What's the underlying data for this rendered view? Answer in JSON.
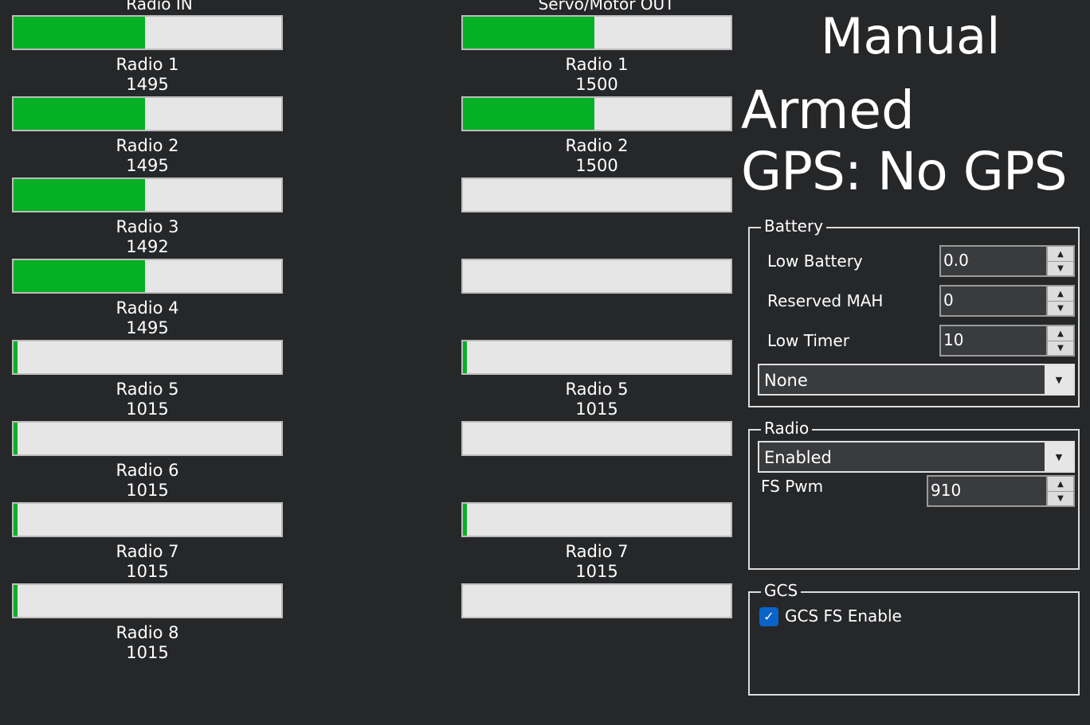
{
  "radio_in": {
    "title": "Radio IN",
    "channels": [
      {
        "label": "Radio 1",
        "value": "1495",
        "level": 0.49
      },
      {
        "label": "Radio 2",
        "value": "1495",
        "level": 0.49
      },
      {
        "label": "Radio 3",
        "value": "1492",
        "level": 0.49
      },
      {
        "label": "Radio 4",
        "value": "1495",
        "level": 0.49
      },
      {
        "label": "Radio 5",
        "value": "1015",
        "level": 0.015
      },
      {
        "label": "Radio 6",
        "value": "1015",
        "level": 0.015
      },
      {
        "label": "Radio 7",
        "value": "1015",
        "level": 0.015
      },
      {
        "label": "Radio 8",
        "value": "1015",
        "level": 0.015
      }
    ]
  },
  "servo_out": {
    "title": "Servo/Motor OUT",
    "channels": [
      {
        "label": "Radio 1",
        "value": "1500",
        "level": 0.49
      },
      {
        "label": "Radio 2",
        "value": "1500",
        "level": 0.49
      },
      {
        "label": "",
        "value": "",
        "level": 0
      },
      {
        "label": "",
        "value": "",
        "level": 0
      },
      {
        "label": "Radio 5",
        "value": "1015",
        "level": 0.015
      },
      {
        "label": "",
        "value": "",
        "level": 0
      },
      {
        "label": "Radio 7",
        "value": "1015",
        "level": 0.015
      },
      {
        "label": "",
        "value": "",
        "level": 0
      }
    ]
  },
  "status": {
    "mode": "Manual",
    "armed": "Armed",
    "gps": "GPS: No GPS"
  },
  "battery": {
    "title": "Battery",
    "low_battery_label": "Low Battery",
    "low_battery_value": "0.0",
    "reserved_mah_label": "Reserved MAH",
    "reserved_mah_value": "0",
    "low_timer_label": "Low Timer",
    "low_timer_value": "10",
    "action_selected": "None"
  },
  "radio": {
    "title": "Radio",
    "mode_selected": "Enabled",
    "fs_pwm_label": "FS Pwm",
    "fs_pwm_value": "910"
  },
  "gcs": {
    "title": "GCS",
    "fs_enable_label": "GCS FS Enable",
    "fs_enable_checked": true
  },
  "colors": {
    "background": "#262729",
    "bar_fill": "#06b025",
    "bar_track": "#e6e6e6",
    "checkbox": "#0a64c8"
  }
}
